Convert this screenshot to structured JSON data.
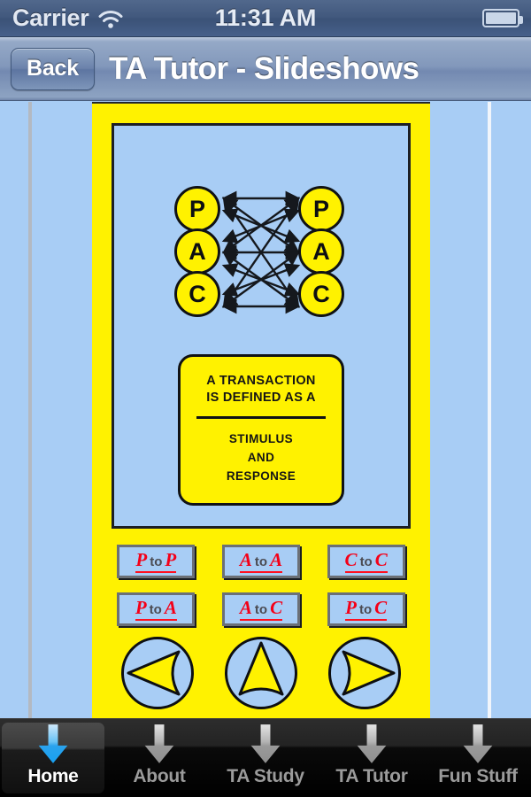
{
  "status_bar": {
    "carrier": "Carrier",
    "time": "11:31 AM",
    "wifi_icon": "wifi-icon",
    "battery_icon": "battery-icon"
  },
  "nav_bar": {
    "back_label": "Back",
    "title": "TA Tutor - Slideshows"
  },
  "slide": {
    "diagram": {
      "left_nodes": [
        "P",
        "A",
        "C"
      ],
      "right_nodes": [
        "P",
        "A",
        "C"
      ],
      "description": "pac-transaction-arrows"
    },
    "definition_box": {
      "line1": "A TRANSACTION",
      "line2": "IS DEFINED AS A",
      "line3": "STIMULUS",
      "line4": "AND",
      "line5": "RESPONSE"
    }
  },
  "transaction_buttons": [
    {
      "from": "P",
      "to_label": "to",
      "to": "P"
    },
    {
      "from": "A",
      "to_label": "to",
      "to": "A"
    },
    {
      "from": "C",
      "to_label": "to",
      "to": "C"
    },
    {
      "from": "P",
      "to_label": "to",
      "to": "A"
    },
    {
      "from": "A",
      "to_label": "to",
      "to": "C"
    },
    {
      "from": "P",
      "to_label": "to",
      "to": "C"
    }
  ],
  "nav_circles": [
    {
      "name": "previous-slide-button",
      "icon": "arrow-left-icon"
    },
    {
      "name": "up-slide-button",
      "icon": "arrow-up-icon"
    },
    {
      "name": "next-slide-button",
      "icon": "arrow-right-icon"
    }
  ],
  "tab_bar": {
    "items": [
      {
        "label": "Home",
        "icon": "down-arrow-icon",
        "active": true
      },
      {
        "label": "About",
        "icon": "down-arrow-icon",
        "active": false
      },
      {
        "label": "TA Study",
        "icon": "down-arrow-icon",
        "active": false
      },
      {
        "label": "TA Tutor",
        "icon": "down-arrow-icon",
        "active": false
      },
      {
        "label": "Fun Stuff",
        "icon": "down-arrow-icon",
        "active": false
      }
    ]
  },
  "colors": {
    "panel_yellow": "#fff200",
    "slide_blue": "#a8cdf5",
    "button_red": "#f40018",
    "active_tab_blue": "#2fa8f0",
    "navbar_blue": "#8298bb"
  }
}
